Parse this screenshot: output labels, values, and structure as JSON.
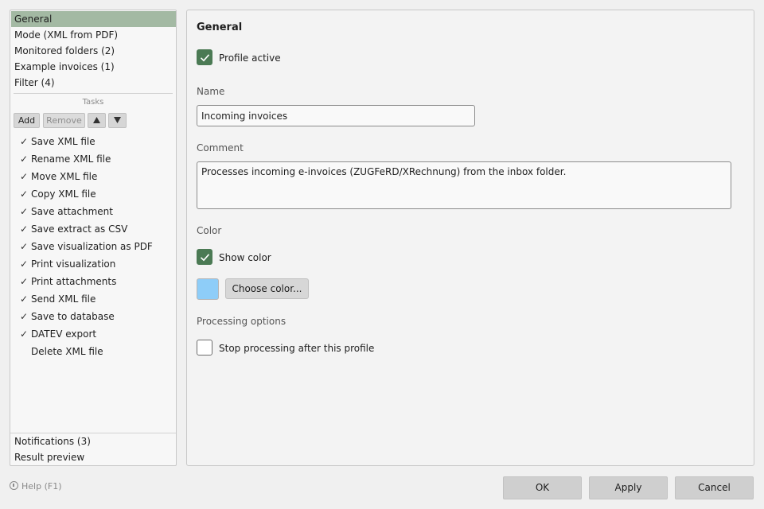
{
  "sidebar": {
    "nav": [
      {
        "label": "General",
        "selected": true
      },
      {
        "label": "Mode (XML from PDF)"
      },
      {
        "label": "Monitored folders (2)"
      },
      {
        "label": "Example invoices (1)"
      },
      {
        "label": "Filter (4)"
      }
    ],
    "tasks_title": "Tasks",
    "toolbar": {
      "add": "Add",
      "remove": "Remove",
      "up_icon": "triangle-up-icon",
      "down_icon": "triangle-down-icon"
    },
    "tasks": [
      {
        "label": "Save XML file",
        "checked": true
      },
      {
        "label": "Rename XML file",
        "checked": true
      },
      {
        "label": "Move XML file",
        "checked": true
      },
      {
        "label": "Copy XML file",
        "checked": true
      },
      {
        "label": "Save attachment",
        "checked": true
      },
      {
        "label": "Save extract as CSV",
        "checked": true
      },
      {
        "label": "Save visualization as PDF",
        "checked": true
      },
      {
        "label": "Print visualization",
        "checked": true
      },
      {
        "label": "Print attachments",
        "checked": true
      },
      {
        "label": "Send XML file",
        "checked": true
      },
      {
        "label": "Save to database",
        "checked": true
      },
      {
        "label": "DATEV export",
        "checked": true
      },
      {
        "label": "Delete XML file",
        "checked": false
      }
    ],
    "bottom": [
      {
        "label": "Notifications (3)"
      },
      {
        "label": "Result preview"
      }
    ],
    "check_glyph": "✓"
  },
  "main": {
    "title": "General",
    "profile_active": {
      "label": "Profile active",
      "checked": true
    },
    "name": {
      "label": "Name",
      "value": "Incoming invoices"
    },
    "comment": {
      "label": "Comment",
      "value": "Processes incoming e-invoices (ZUGFeRD/XRechnung) from the inbox folder."
    },
    "color": {
      "label": "Color",
      "show_color": {
        "label": "Show color",
        "checked": true
      },
      "swatch": "#8ecdf8",
      "choose_button": "Choose color..."
    },
    "processing": {
      "label": "Processing options",
      "stop_after": {
        "label": "Stop processing after this profile",
        "checked": false
      }
    }
  },
  "footer": {
    "help": "Help (F1)",
    "ok": "OK",
    "apply": "Apply",
    "cancel": "Cancel"
  },
  "colors": {
    "accent": "#4b7a54",
    "selection": "#a3b9a3"
  }
}
